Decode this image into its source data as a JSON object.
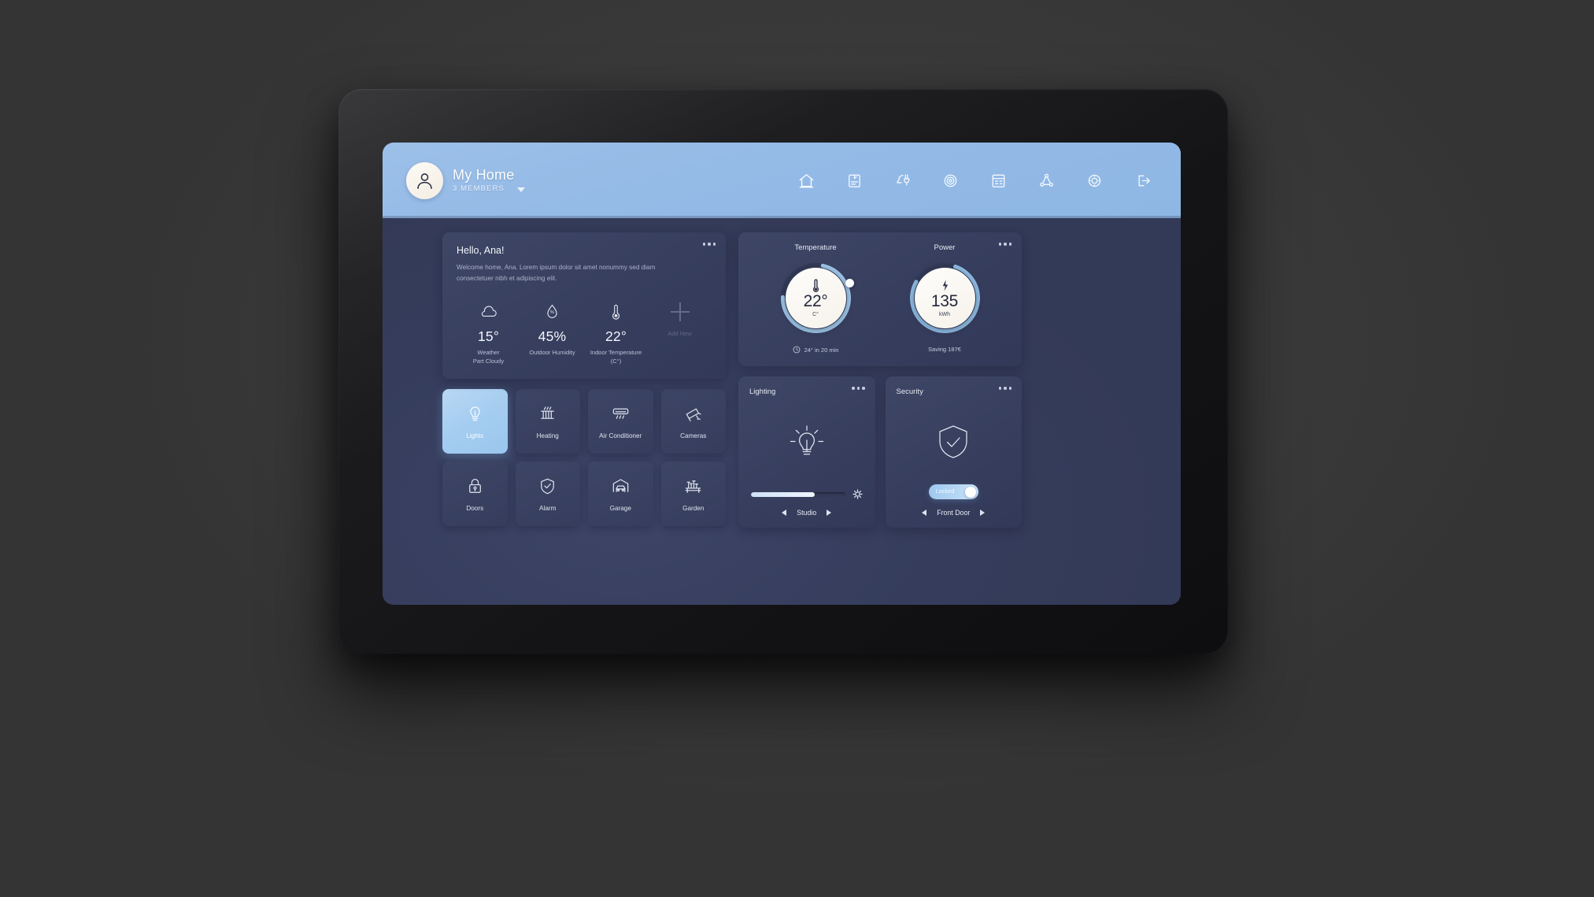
{
  "header": {
    "home_title": "My Home",
    "members": "3 MEMBERS",
    "avatar_icon": "user-avatar-icon",
    "dropdown_icon": "chevron-down-icon",
    "nav": [
      {
        "name": "home",
        "icon": "home-icon",
        "active": true
      },
      {
        "name": "devices",
        "icon": "device-screen-icon",
        "active": false
      },
      {
        "name": "energy",
        "icon": "plug-lamp-icon",
        "active": false
      },
      {
        "name": "scenes",
        "icon": "target-scenes-icon",
        "active": false
      },
      {
        "name": "schedule",
        "icon": "calendar-icon",
        "active": false
      },
      {
        "name": "automation",
        "icon": "network-nodes-icon",
        "active": false
      },
      {
        "name": "settings",
        "icon": "gear-settings-icon",
        "active": false
      },
      {
        "name": "logout",
        "icon": "logout-icon",
        "active": false
      }
    ]
  },
  "greeting": {
    "title": "Hello, Ana!",
    "body": "Welcome home, Ana. Lorem ipsum dolor sit amet nonummy sed diam consectetuer nibh et adipiscing elit.",
    "menu_icon": "more-options-icon",
    "stats": [
      {
        "icon": "cloud-icon",
        "value": "15°",
        "label": "Weather\nPart Cloudy"
      },
      {
        "icon": "humidity-drop-icon",
        "value": "45%",
        "label": "Outdoor Humidity"
      },
      {
        "icon": "thermometer-icon",
        "value": "22°",
        "label": "Indoor Temperature\n(C°)"
      },
      {
        "icon": "plus-icon",
        "value": "",
        "label": "Add New"
      }
    ]
  },
  "devices": {
    "tiles": [
      {
        "label": "Lights",
        "icon": "lightbulb-icon",
        "active": true
      },
      {
        "label": "Heating",
        "icon": "radiator-icon",
        "active": false
      },
      {
        "label": "Air Conditioner",
        "icon": "air-conditioner-icon",
        "active": false
      },
      {
        "label": "Cameras",
        "icon": "security-camera-icon",
        "active": false
      },
      {
        "label": "Doors",
        "icon": "padlock-icon",
        "active": false
      },
      {
        "label": "Alarm",
        "icon": "shield-check-icon",
        "active": false
      },
      {
        "label": "Garage",
        "icon": "garage-car-icon",
        "active": false
      },
      {
        "label": "Garden",
        "icon": "garden-bench-icon",
        "active": false
      }
    ]
  },
  "temperature": {
    "title": "Temperature",
    "value": "22°",
    "unit": "C°",
    "icon": "thermometer-icon",
    "footer": "24° in 20 min",
    "footer_icon": "clock-icon",
    "progress_percent": 72,
    "arc_color": "#9fc6e8"
  },
  "power": {
    "title": "Power",
    "value": "135",
    "unit": "kWh",
    "icon": "lightning-bolt-icon",
    "footer": "Saving 187€",
    "menu_icon": "more-options-icon",
    "progress_percent": 78,
    "arc_color": "#8fbbe2"
  },
  "lighting": {
    "title": "Lighting",
    "menu_icon": "more-options-icon",
    "bulb_icon": "lightbulb-rays-icon",
    "brightness_percent": 68,
    "brightness_icon": "brightness-sun-icon",
    "room": "Studio",
    "prev_icon": "arrow-left-icon",
    "next_icon": "arrow-right-icon"
  },
  "security": {
    "title": "Security",
    "menu_icon": "more-options-icon",
    "shield_icon": "shield-check-icon",
    "toggle_label": "Locked",
    "toggle_on": true,
    "zone": "Front Door",
    "prev_icon": "arrow-left-icon",
    "next_icon": "arrow-right-icon"
  }
}
